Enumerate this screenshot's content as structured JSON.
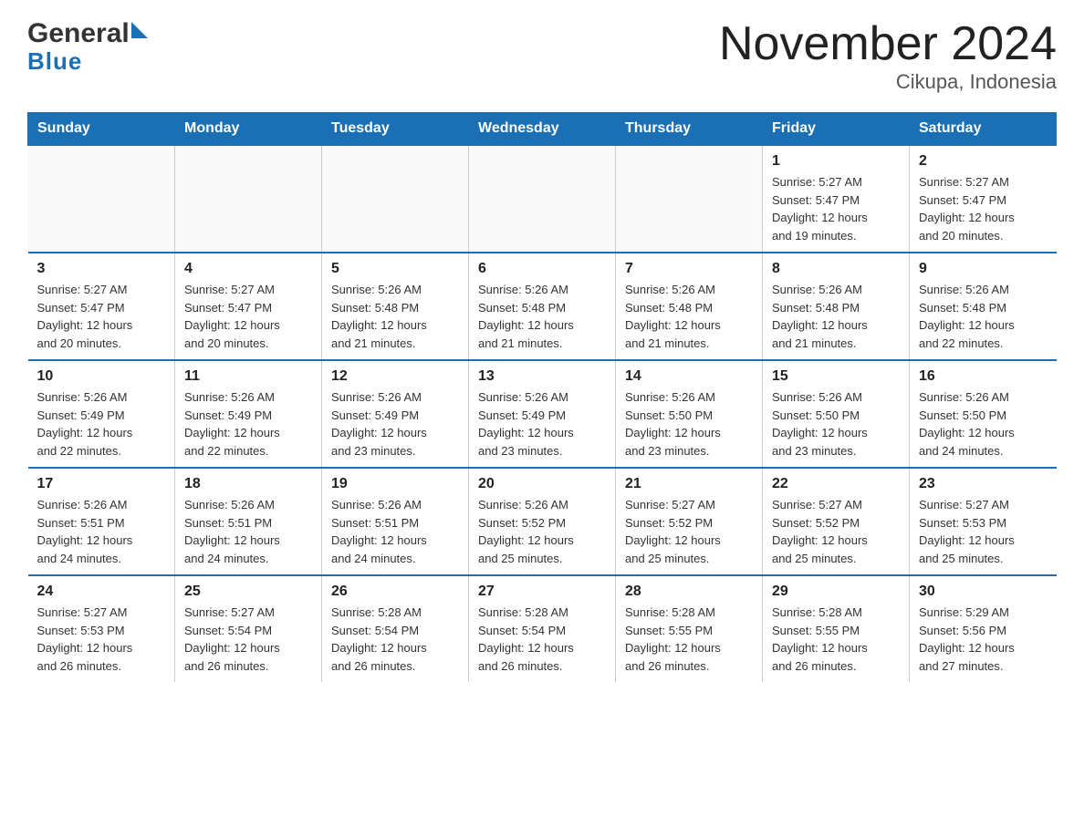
{
  "header": {
    "title": "November 2024",
    "subtitle": "Cikupa, Indonesia",
    "logo_general": "General",
    "logo_blue": "Blue"
  },
  "weekdays": [
    "Sunday",
    "Monday",
    "Tuesday",
    "Wednesday",
    "Thursday",
    "Friday",
    "Saturday"
  ],
  "weeks": [
    [
      {
        "day": "",
        "info": ""
      },
      {
        "day": "",
        "info": ""
      },
      {
        "day": "",
        "info": ""
      },
      {
        "day": "",
        "info": ""
      },
      {
        "day": "",
        "info": ""
      },
      {
        "day": "1",
        "info": "Sunrise: 5:27 AM\nSunset: 5:47 PM\nDaylight: 12 hours\nand 19 minutes."
      },
      {
        "day": "2",
        "info": "Sunrise: 5:27 AM\nSunset: 5:47 PM\nDaylight: 12 hours\nand 20 minutes."
      }
    ],
    [
      {
        "day": "3",
        "info": "Sunrise: 5:27 AM\nSunset: 5:47 PM\nDaylight: 12 hours\nand 20 minutes."
      },
      {
        "day": "4",
        "info": "Sunrise: 5:27 AM\nSunset: 5:47 PM\nDaylight: 12 hours\nand 20 minutes."
      },
      {
        "day": "5",
        "info": "Sunrise: 5:26 AM\nSunset: 5:48 PM\nDaylight: 12 hours\nand 21 minutes."
      },
      {
        "day": "6",
        "info": "Sunrise: 5:26 AM\nSunset: 5:48 PM\nDaylight: 12 hours\nand 21 minutes."
      },
      {
        "day": "7",
        "info": "Sunrise: 5:26 AM\nSunset: 5:48 PM\nDaylight: 12 hours\nand 21 minutes."
      },
      {
        "day": "8",
        "info": "Sunrise: 5:26 AM\nSunset: 5:48 PM\nDaylight: 12 hours\nand 21 minutes."
      },
      {
        "day": "9",
        "info": "Sunrise: 5:26 AM\nSunset: 5:48 PM\nDaylight: 12 hours\nand 22 minutes."
      }
    ],
    [
      {
        "day": "10",
        "info": "Sunrise: 5:26 AM\nSunset: 5:49 PM\nDaylight: 12 hours\nand 22 minutes."
      },
      {
        "day": "11",
        "info": "Sunrise: 5:26 AM\nSunset: 5:49 PM\nDaylight: 12 hours\nand 22 minutes."
      },
      {
        "day": "12",
        "info": "Sunrise: 5:26 AM\nSunset: 5:49 PM\nDaylight: 12 hours\nand 23 minutes."
      },
      {
        "day": "13",
        "info": "Sunrise: 5:26 AM\nSunset: 5:49 PM\nDaylight: 12 hours\nand 23 minutes."
      },
      {
        "day": "14",
        "info": "Sunrise: 5:26 AM\nSunset: 5:50 PM\nDaylight: 12 hours\nand 23 minutes."
      },
      {
        "day": "15",
        "info": "Sunrise: 5:26 AM\nSunset: 5:50 PM\nDaylight: 12 hours\nand 23 minutes."
      },
      {
        "day": "16",
        "info": "Sunrise: 5:26 AM\nSunset: 5:50 PM\nDaylight: 12 hours\nand 24 minutes."
      }
    ],
    [
      {
        "day": "17",
        "info": "Sunrise: 5:26 AM\nSunset: 5:51 PM\nDaylight: 12 hours\nand 24 minutes."
      },
      {
        "day": "18",
        "info": "Sunrise: 5:26 AM\nSunset: 5:51 PM\nDaylight: 12 hours\nand 24 minutes."
      },
      {
        "day": "19",
        "info": "Sunrise: 5:26 AM\nSunset: 5:51 PM\nDaylight: 12 hours\nand 24 minutes."
      },
      {
        "day": "20",
        "info": "Sunrise: 5:26 AM\nSunset: 5:52 PM\nDaylight: 12 hours\nand 25 minutes."
      },
      {
        "day": "21",
        "info": "Sunrise: 5:27 AM\nSunset: 5:52 PM\nDaylight: 12 hours\nand 25 minutes."
      },
      {
        "day": "22",
        "info": "Sunrise: 5:27 AM\nSunset: 5:52 PM\nDaylight: 12 hours\nand 25 minutes."
      },
      {
        "day": "23",
        "info": "Sunrise: 5:27 AM\nSunset: 5:53 PM\nDaylight: 12 hours\nand 25 minutes."
      }
    ],
    [
      {
        "day": "24",
        "info": "Sunrise: 5:27 AM\nSunset: 5:53 PM\nDaylight: 12 hours\nand 26 minutes."
      },
      {
        "day": "25",
        "info": "Sunrise: 5:27 AM\nSunset: 5:54 PM\nDaylight: 12 hours\nand 26 minutes."
      },
      {
        "day": "26",
        "info": "Sunrise: 5:28 AM\nSunset: 5:54 PM\nDaylight: 12 hours\nand 26 minutes."
      },
      {
        "day": "27",
        "info": "Sunrise: 5:28 AM\nSunset: 5:54 PM\nDaylight: 12 hours\nand 26 minutes."
      },
      {
        "day": "28",
        "info": "Sunrise: 5:28 AM\nSunset: 5:55 PM\nDaylight: 12 hours\nand 26 minutes."
      },
      {
        "day": "29",
        "info": "Sunrise: 5:28 AM\nSunset: 5:55 PM\nDaylight: 12 hours\nand 26 minutes."
      },
      {
        "day": "30",
        "info": "Sunrise: 5:29 AM\nSunset: 5:56 PM\nDaylight: 12 hours\nand 27 minutes."
      }
    ]
  ]
}
